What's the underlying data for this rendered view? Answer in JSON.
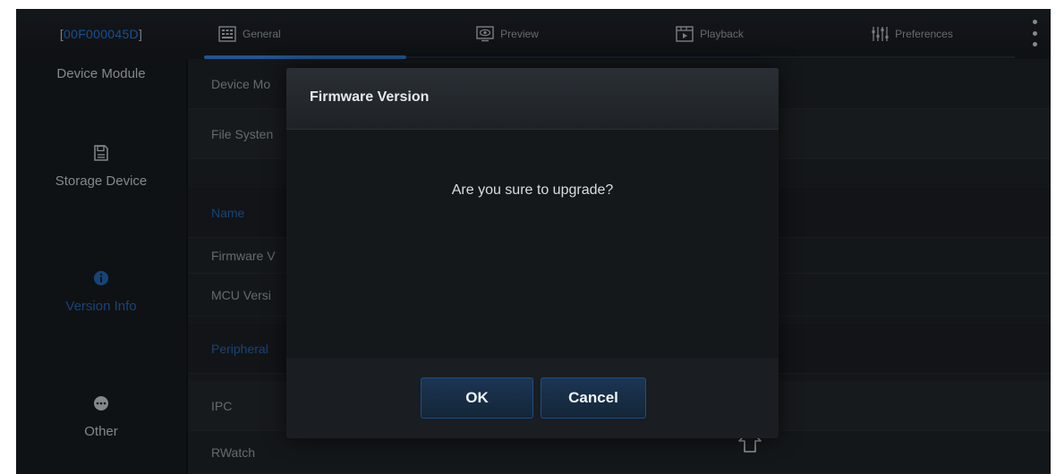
{
  "header": {
    "device_id_open": "[ ",
    "device_id": "00F000045D",
    "device_id_close": " ]",
    "tabs": [
      {
        "label": "General",
        "icon": "general-icon"
      },
      {
        "label": "Preview",
        "icon": "preview-eye-icon"
      },
      {
        "label": "Playback",
        "icon": "playback-icon"
      },
      {
        "label": "Preferences",
        "icon": "sliders-icon"
      }
    ],
    "active_tab": "General"
  },
  "sidebar": {
    "items": [
      {
        "label": "Device Module",
        "icon": ""
      },
      {
        "label": "Storage Device",
        "icon": "floppy-disk-icon"
      },
      {
        "label": "Version Info",
        "icon": "info-icon",
        "active": true
      },
      {
        "label": "Other",
        "icon": "more-dots-icon"
      }
    ]
  },
  "content": {
    "rows": [
      {
        "label": "Device Mo",
        "type": "item"
      },
      {
        "label": "File Systen",
        "type": "item"
      },
      {
        "label": "Name",
        "type": "section"
      },
      {
        "label": "Firmware V",
        "type": "item"
      },
      {
        "label": "MCU Versi",
        "type": "item"
      },
      {
        "label": "Peripheral",
        "type": "section"
      },
      {
        "label": "IPC",
        "type": "item"
      },
      {
        "label": "RWatch",
        "type": "item"
      }
    ]
  },
  "dialog": {
    "title": "Firmware Version",
    "message": "Are you sure to upgrade?",
    "ok_label": "OK",
    "cancel_label": "Cancel"
  },
  "colors": {
    "accent": "#2b77c8",
    "section_text": "#1f5fa8",
    "background": "#101418"
  }
}
